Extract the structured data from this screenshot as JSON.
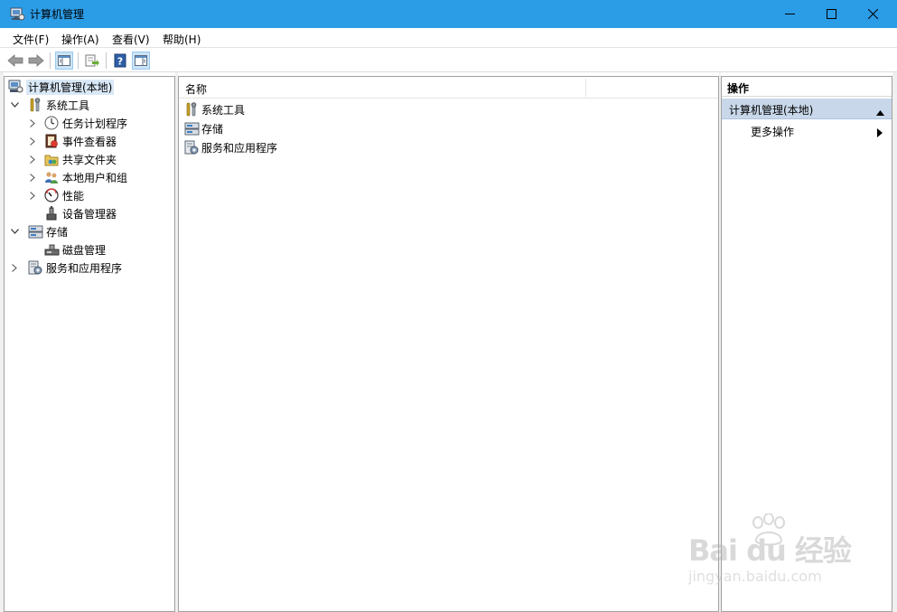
{
  "window": {
    "title": "计算机管理"
  },
  "menubar": {
    "items": [
      "文件(F)",
      "操作(A)",
      "查看(V)",
      "帮助(H)"
    ]
  },
  "tree": {
    "root": "计算机管理(本地)",
    "system_tools": "系统工具",
    "task_scheduler": "任务计划程序",
    "event_viewer": "事件查看器",
    "shared_folders": "共享文件夹",
    "local_users": "本地用户和组",
    "performance": "性能",
    "device_manager": "设备管理器",
    "storage": "存储",
    "disk_management": "磁盘管理",
    "services_apps": "服务和应用程序"
  },
  "list": {
    "column_name": "名称",
    "rows": [
      "系统工具",
      "存储",
      "服务和应用程序"
    ]
  },
  "actions": {
    "header": "操作",
    "section": "计算机管理(本地)",
    "more": "更多操作"
  },
  "watermark": {
    "brand": "Bai du 经验",
    "url": "jingyan.baidu.com"
  },
  "colors": {
    "titlebar": "#2b9ce6",
    "selection": "#d9e8f7",
    "action_section": "#c8d8ea"
  }
}
